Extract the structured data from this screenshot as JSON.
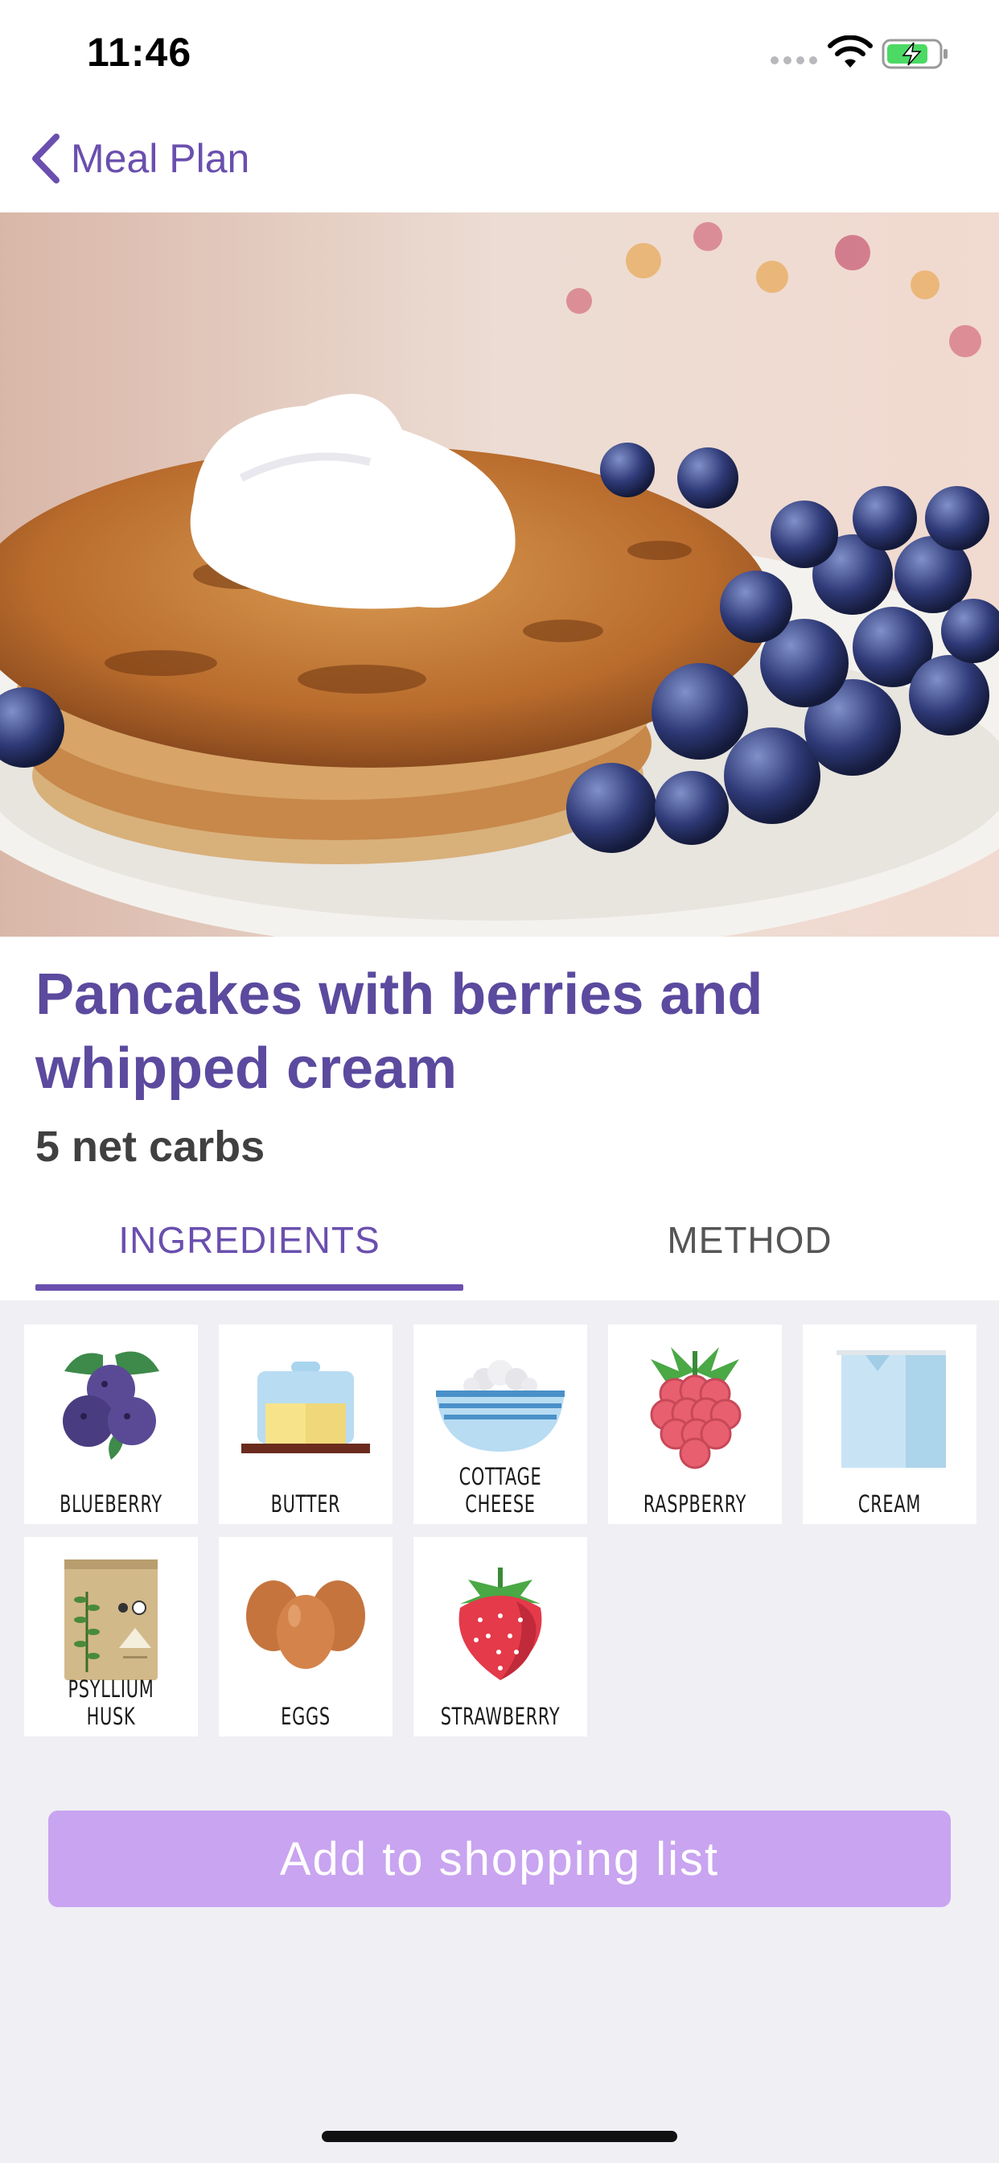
{
  "status_bar": {
    "time": "11:46",
    "icons": [
      "signal-icon",
      "wifi-icon",
      "battery-charging-icon"
    ]
  },
  "nav": {
    "back_label": "Meal Plan",
    "back_icon": "chevron-left-icon"
  },
  "hero": {
    "image_subject": "pancakes-with-berries-and-cream-photo"
  },
  "recipe": {
    "title": "Pancakes with berries and whipped cream",
    "net_carbs": "5 net carbs"
  },
  "tabs": [
    {
      "label": "INGREDIENTS",
      "selected": true
    },
    {
      "label": "METHOD",
      "selected": false
    }
  ],
  "ingredients": [
    {
      "label": "BLUEBERRY",
      "icon": "blueberry-icon"
    },
    {
      "label": "BUTTER",
      "icon": "butter-icon"
    },
    {
      "label": "COTTAGE CHEESE",
      "icon": "cottage-cheese-icon"
    },
    {
      "label": "RASPBERRY",
      "icon": "raspberry-icon"
    },
    {
      "label": "CREAM",
      "icon": "cream-icon"
    },
    {
      "label": "PSYLLIUM HUSK",
      "icon": "psyllium-husk-icon"
    },
    {
      "label": "EGGS",
      "icon": "eggs-icon"
    },
    {
      "label": "STRAWBERRY",
      "icon": "strawberry-icon"
    }
  ],
  "actions": {
    "add_to_shopping_list": "Add to shopping list"
  },
  "colors": {
    "accent": "#6a4fae",
    "title": "#5b4a9e",
    "button": "#c9a4f0",
    "background": "#efeff4"
  }
}
